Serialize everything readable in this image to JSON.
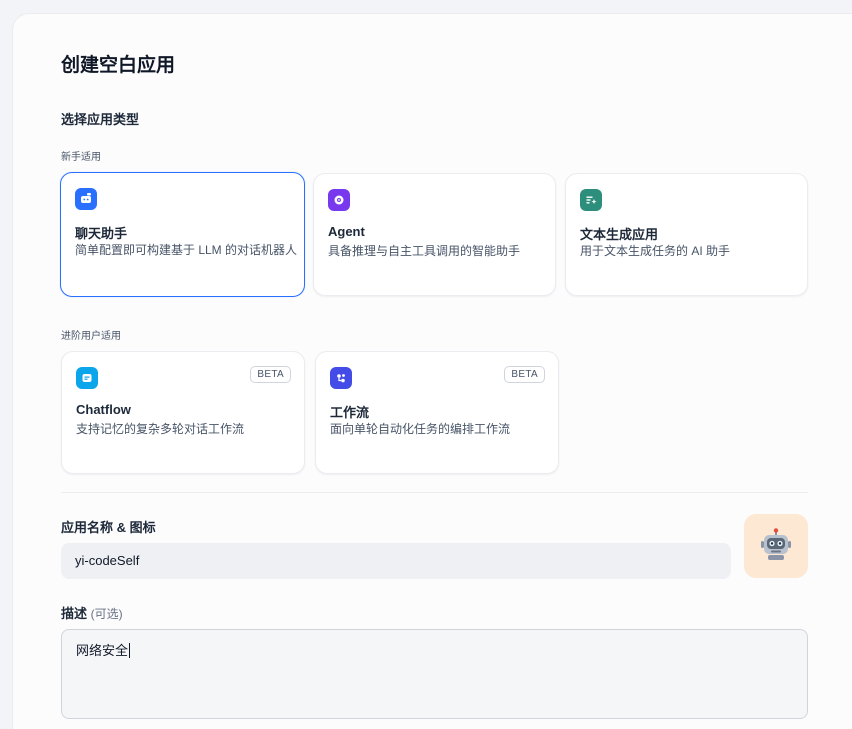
{
  "dialog": {
    "title": "创建空白应用",
    "app_type_heading": "选择应用类型",
    "beginner_label": "新手适用",
    "advanced_label": "进阶用户适用"
  },
  "beginner_cards": [
    {
      "title": "聊天助手",
      "desc": "简单配置即可构建基于 LLM 的对话机器人",
      "icon": "chat-bot-icon",
      "color": "#2970ff",
      "selected": true
    },
    {
      "title": "Agent",
      "desc": "具备推理与自主工具调用的智能助手",
      "icon": "agent-icon",
      "color": "#7839ee",
      "selected": false
    },
    {
      "title": "文本生成应用",
      "desc": "用于文本生成任务的 AI 助手",
      "icon": "text-generator-icon",
      "color": "#2c8e7b",
      "selected": false
    }
  ],
  "advanced_cards": [
    {
      "title": "Chatflow",
      "desc": "支持记忆的复杂多轮对话工作流",
      "icon": "chatflow-icon",
      "color": "#0ba5ec",
      "badge": "BETA"
    },
    {
      "title": "工作流",
      "desc": "面向单轮自动化任务的编排工作流",
      "icon": "workflow-icon",
      "color": "#444ce7",
      "badge": "BETA"
    }
  ],
  "name_field": {
    "label": "应用名称 & 图标",
    "value": "yi-codeSelf",
    "icon": "robot-emoji-icon",
    "emoji": "🤖",
    "icon_bg": "#fde8d4"
  },
  "description_field": {
    "label": "描述",
    "optional": "(可选)",
    "value": "网络安全"
  }
}
